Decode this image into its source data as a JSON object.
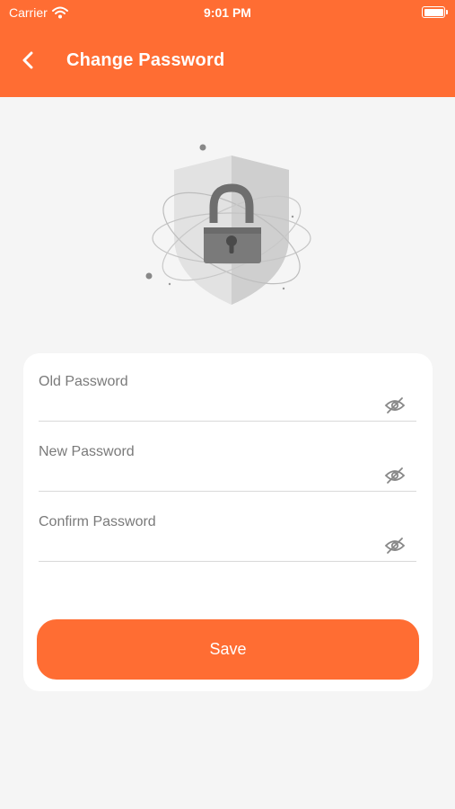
{
  "status_bar": {
    "carrier": "Carrier",
    "time": "9:01 PM"
  },
  "header": {
    "title": "Change Password",
    "back_icon": "chevron-left-icon"
  },
  "illustration": {
    "icon": "shield-lock-icon"
  },
  "form": {
    "fields": [
      {
        "label": "Old Password",
        "value": "",
        "icon": "eye-off-icon"
      },
      {
        "label": "New Password",
        "value": "",
        "icon": "eye-off-icon"
      },
      {
        "label": "Confirm Password",
        "value": "",
        "icon": "eye-off-icon"
      }
    ],
    "save_label": "Save"
  },
  "colors": {
    "accent": "#ff6d33",
    "background": "#f5f5f5",
    "card": "#ffffff",
    "label": "#7a7a7a"
  }
}
